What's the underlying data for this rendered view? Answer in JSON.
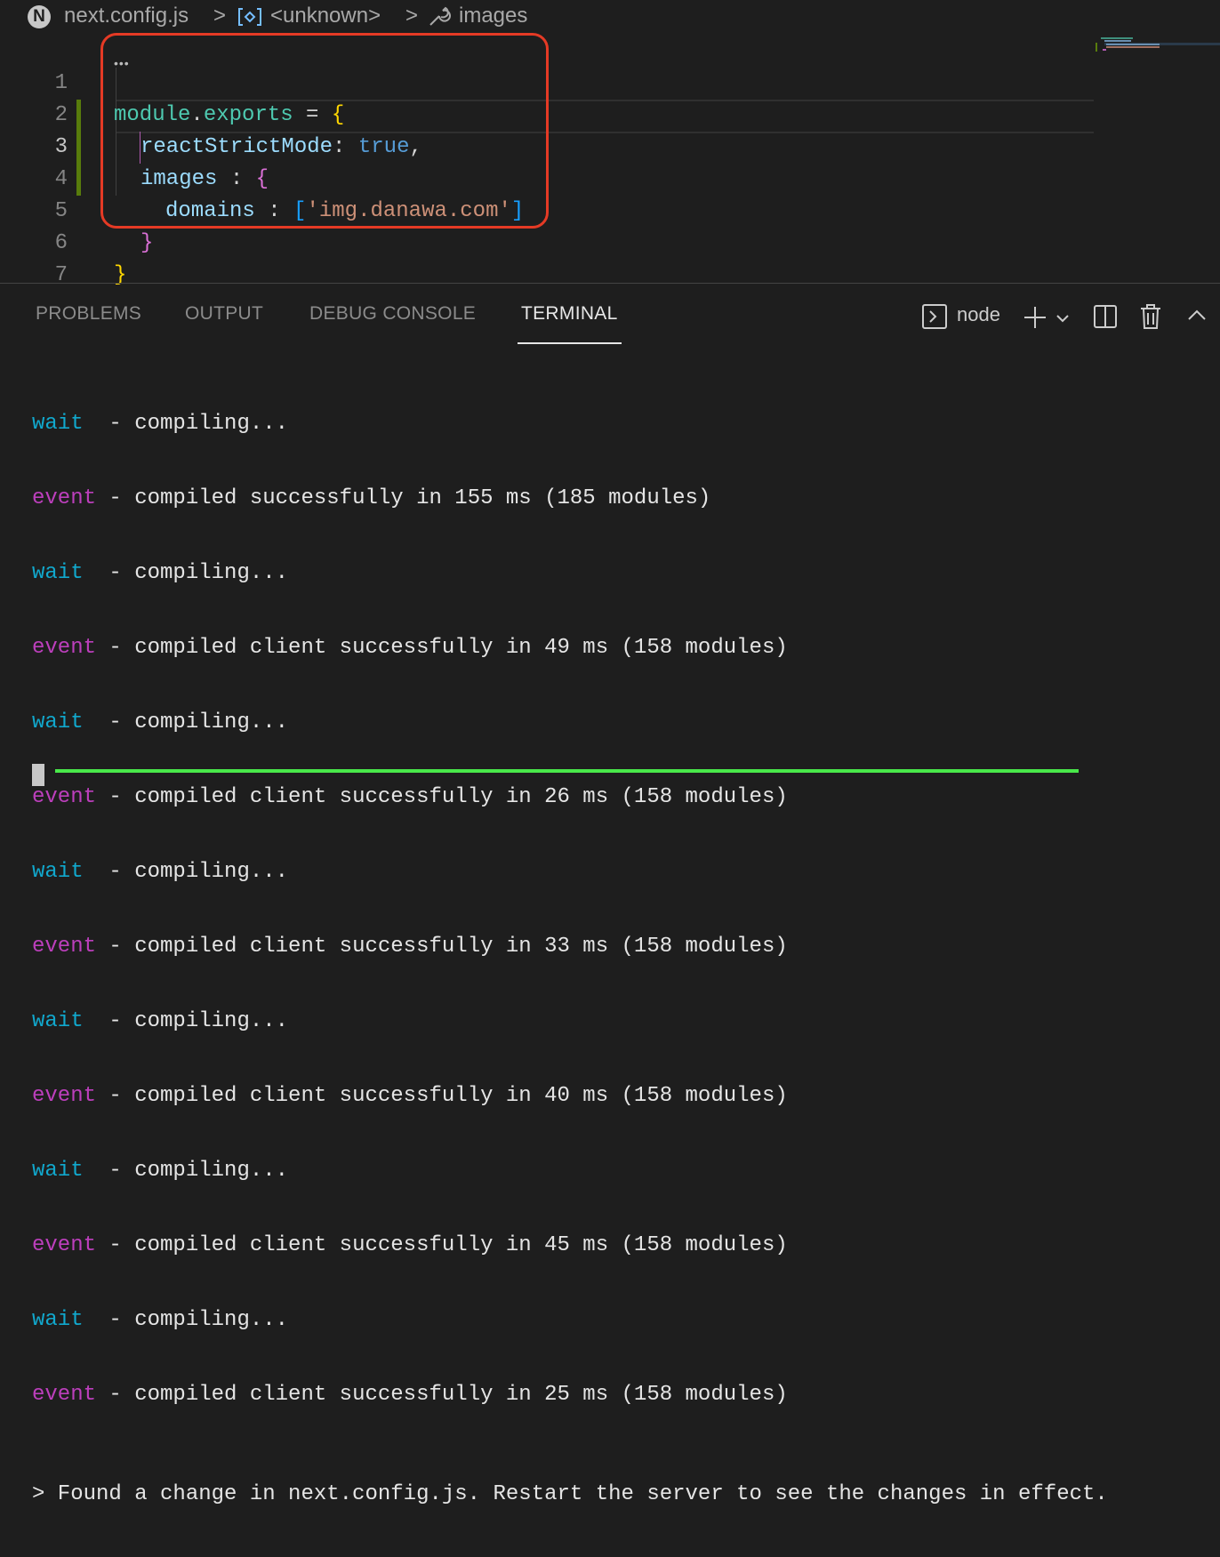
{
  "breadcrumb": {
    "logo_letter": "N",
    "file": "next.config.js",
    "separator": ">",
    "symbol": "<unknown>",
    "property": "images"
  },
  "editor": {
    "lines": [
      {
        "num": "1"
      },
      {
        "num": "2"
      },
      {
        "num": "3"
      },
      {
        "num": "4"
      },
      {
        "num": "5"
      },
      {
        "num": "6"
      },
      {
        "num": "7"
      }
    ],
    "code": {
      "l1_module": "module",
      "l1_dot": ".",
      "l1_exports": "exports",
      "l1_eq": " = ",
      "l1_brace": "{",
      "l2_key": "reactStrictMode",
      "l2_colon": ": ",
      "l2_value": "true",
      "l2_comma": ",",
      "l3_key": "images",
      "l3_colon": " : ",
      "l3_brace": "{",
      "l4_key": "domains",
      "l4_colon": " : ",
      "l4_open": "[",
      "l4_string": "'img.danawa.com'",
      "l4_close": "]",
      "l5_brace": "}",
      "l6_brace": "}"
    }
  },
  "panel": {
    "tabs": [
      "PROBLEMS",
      "OUTPUT",
      "DEBUG CONSOLE",
      "TERMINAL"
    ],
    "active_tab": "TERMINAL",
    "terminal_name": "node"
  },
  "terminal": {
    "lines": [
      {
        "kw": "wait",
        "pad": "  ",
        "text": "- compiling..."
      },
      {
        "kw": "event",
        "pad": " ",
        "text": "- compiled successfully in 155 ms (185 modules)"
      },
      {
        "kw": "wait",
        "pad": "  ",
        "text": "- compiling..."
      },
      {
        "kw": "event",
        "pad": " ",
        "text": "- compiled client successfully in 49 ms (158 modules)"
      },
      {
        "kw": "wait",
        "pad": "  ",
        "text": "- compiling..."
      },
      {
        "kw": "event",
        "pad": " ",
        "text": "- compiled client successfully in 26 ms (158 modules)"
      },
      {
        "kw": "wait",
        "pad": "  ",
        "text": "- compiling..."
      },
      {
        "kw": "event",
        "pad": " ",
        "text": "- compiled client successfully in 33 ms (158 modules)"
      },
      {
        "kw": "wait",
        "pad": "  ",
        "text": "- compiling..."
      },
      {
        "kw": "event",
        "pad": " ",
        "text": "- compiled client successfully in 40 ms (158 modules)"
      },
      {
        "kw": "wait",
        "pad": "  ",
        "text": "- compiling..."
      },
      {
        "kw": "event",
        "pad": " ",
        "text": "- compiled client successfully in 45 ms (158 modules)"
      },
      {
        "kw": "wait",
        "pad": "  ",
        "text": "- compiling..."
      },
      {
        "kw": "event",
        "pad": " ",
        "text": "- compiled client successfully in 25 ms (158 modules)"
      }
    ],
    "message": "> Found a change in next.config.js. Restart the server to see the changes in effect."
  },
  "colors": {
    "annotation_box": "#e53a25",
    "annotation_underline": "#49e84a",
    "wait": "#11a8cd",
    "event": "#bc3fbc"
  }
}
